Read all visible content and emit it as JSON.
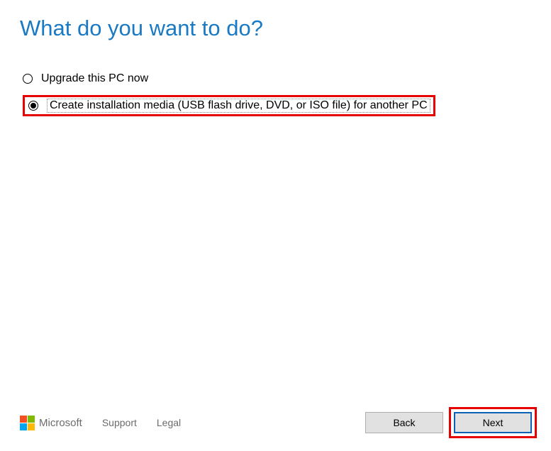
{
  "title": "What do you want to do?",
  "options": [
    {
      "label": "Upgrade this PC now",
      "selected": false
    },
    {
      "label": "Create installation media (USB flash drive, DVD, or ISO file) for another PC",
      "selected": true
    }
  ],
  "footer": {
    "brand": "Microsoft",
    "links": {
      "support": "Support",
      "legal": "Legal"
    }
  },
  "buttons": {
    "back": "Back",
    "next": "Next"
  },
  "colors": {
    "accent": "#1979c3",
    "highlight": "#e60000",
    "next_border": "#0b61b5"
  }
}
